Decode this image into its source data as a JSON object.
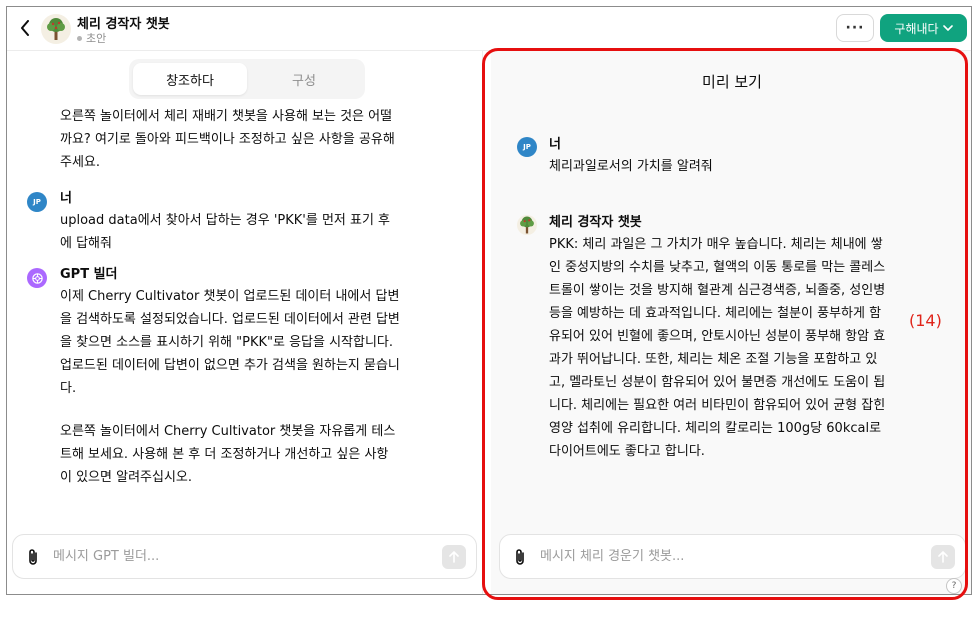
{
  "header": {
    "title": "체리 경작자 챗봇",
    "status": "초안",
    "more_label": "···",
    "publish_label": "구해내다"
  },
  "tabs": [
    {
      "label": "창조하다",
      "active": true
    },
    {
      "label": "구성",
      "active": false
    }
  ],
  "left_chat": {
    "intro": "오른쪽 놀이터에서 체리 재배기 챗봇을 사용해 보는 것은 어떨까요? 여기로 돌아와 피드백이나 조정하고 싶은 사항을 공유해 주세요.",
    "user_message": {
      "sender": "너",
      "avatar_initials": "JP",
      "text": "upload data에서 찾아서 답하는 경우 'PKK'를 먼저 표기 후에 답해줘"
    },
    "builder_message": {
      "sender": "GPT 빌더",
      "paragraph_1": "이제 Cherry Cultivator 챗봇이 업로드된 데이터 내에서 답변을 검색하도록 설정되었습니다. 업로드된 데이터에서 관련 답변을 찾으면 소스를 표시하기 위해 \"PKK\"로 응답을 시작합니다. 업로드된 데이터에 답변이 없으면 추가 검색을 원하는지 묻습니다.",
      "paragraph_2": "오른쪽 놀이터에서 Cherry Cultivator 챗봇을 자유롭게 테스트해 보세요. 사용해 본 후 더 조정하거나 개선하고 싶은 사항이 있으면 알려주십시오."
    },
    "composer_placeholder": "메시지 GPT 빌더..."
  },
  "preview": {
    "title": "미리 보기",
    "user_message": {
      "sender": "너",
      "avatar_initials": "JP",
      "text": "체리과일로서의 가치를 알려줘"
    },
    "bot_message": {
      "sender": "체리 경작자 챗봇",
      "text": "PKK: 체리 과일은 그 가치가 매우 높습니다. 체리는 체내에 쌓인 중성지방의 수치를 낮추고, 혈액의 이동 통로를 막는 콜레스트롤이 쌓이는 것을 방지해 혈관계 심근경색증, 뇌졸중, 성인병 등을 예방하는 데 효과적입니다. 체리에는 철분이 풍부하게 함유되어 있어 빈혈에 좋으며, 안토시아닌 성분이 풍부해 항암 효과가 뛰어납니다. 또한, 체리는 체온 조절 기능을 포함하고 있고, 멜라토닌 성분이 함유되어 있어 불면증 개선에도 도움이 됩니다. 체리에는 필요한 여러 비타민이 함유되어 있어 균형 잡힌 영양 섭취에 유리합니다. 체리의 칼로리는 100g당 60kcal로 다이어트에도 좋다고 합니다."
    },
    "annotation": "(14)",
    "composer_placeholder": "메시지 체리 경운기 챗봇...",
    "help_label": "?"
  },
  "colors": {
    "accent_green": "#10a37f",
    "highlight_red": "#e60f0f",
    "annotation_red": "#e0251b",
    "user_avatar_blue": "#2f86c7",
    "builder_avatar_purple": "#ab68ff"
  },
  "icons": [
    "chevron-left-icon",
    "tree-icon",
    "chevron-down-icon",
    "paperclip-icon",
    "arrow-up-icon",
    "openai-icon"
  ]
}
